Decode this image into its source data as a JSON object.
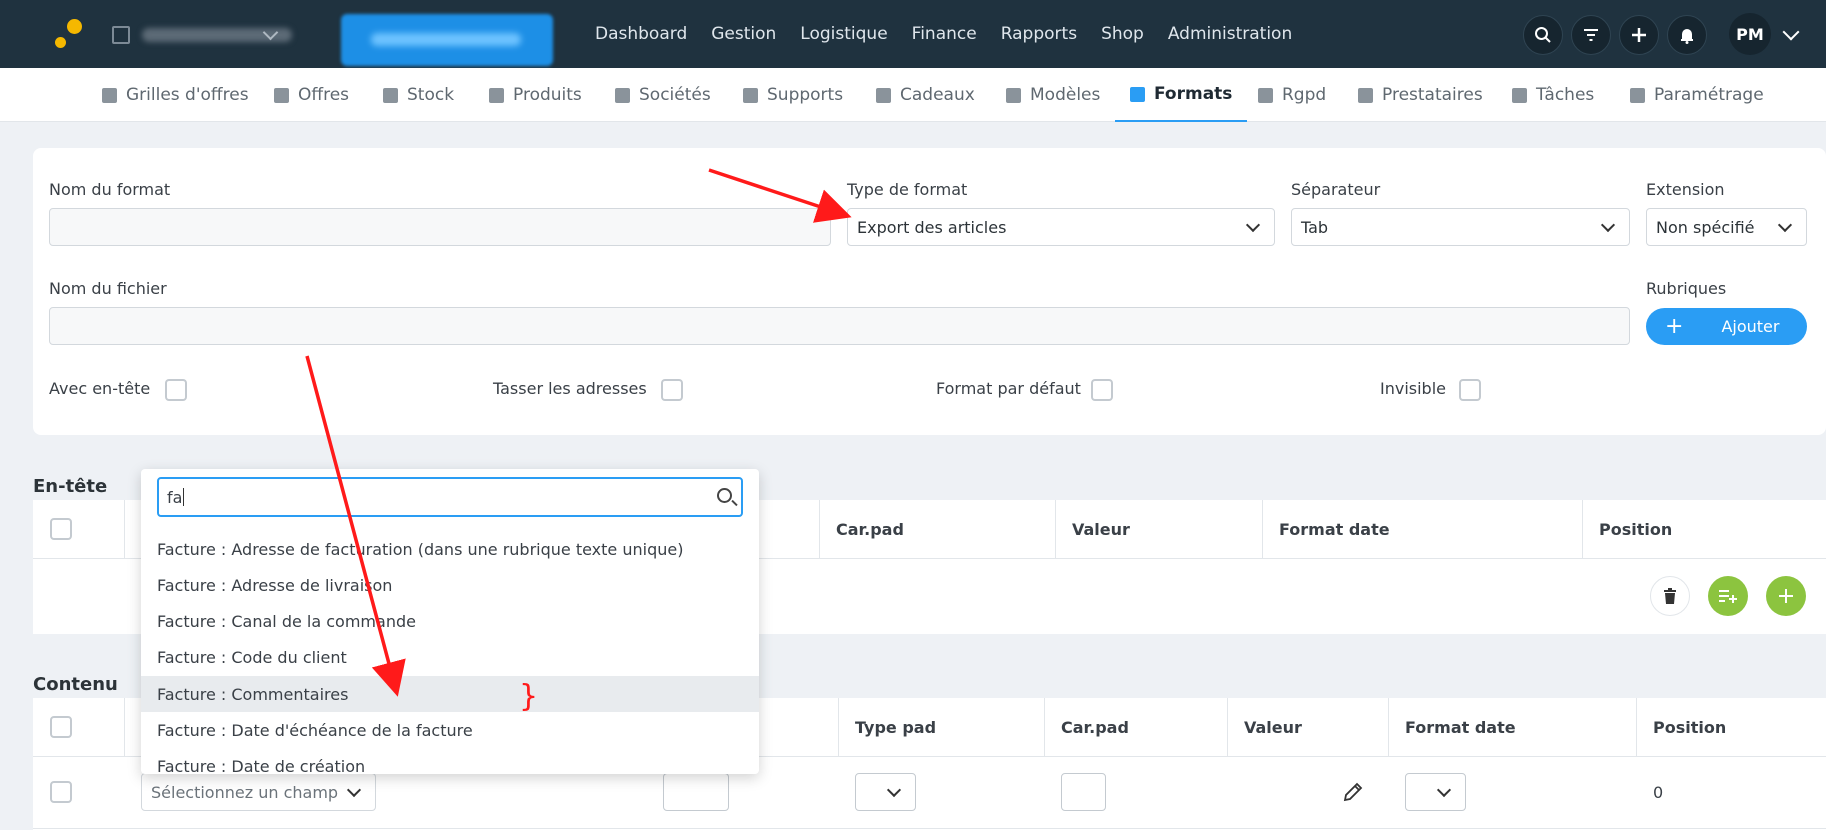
{
  "topbar": {
    "nav": [
      "Dashboard",
      "Gestion",
      "Logistique",
      "Finance",
      "Rapports",
      "Shop",
      "Administration"
    ],
    "avatar": "PM",
    "icons": [
      "search-icon",
      "filter-icon",
      "plus-icon",
      "bell-icon"
    ]
  },
  "subnav": {
    "items": [
      {
        "label": "Grilles d'offres",
        "icon": "grid-icon"
      },
      {
        "label": "Offres",
        "icon": "book-icon"
      },
      {
        "label": "Stock",
        "icon": "cloud-upload-icon"
      },
      {
        "label": "Produits",
        "icon": "cart-icon"
      },
      {
        "label": "Sociétés",
        "icon": "building-icon"
      },
      {
        "label": "Supports",
        "icon": "help-circle-icon"
      },
      {
        "label": "Cadeaux",
        "icon": "gift-icon"
      },
      {
        "label": "Modèles",
        "icon": "paint-roller-icon"
      },
      {
        "label": "Formats",
        "icon": "file-icon"
      },
      {
        "label": "Rgpd",
        "icon": "check-square-icon"
      },
      {
        "label": "Prestataires",
        "icon": "download-icon"
      },
      {
        "label": "Tâches",
        "icon": "calendar-check-icon"
      },
      {
        "label": "Paramétrage",
        "icon": "gear-icon"
      }
    ],
    "active": "Formats"
  },
  "form": {
    "nom_format_label": "Nom du format",
    "type_format_label": "Type de format",
    "type_format_value": "Export des articles",
    "separateur_label": "Séparateur",
    "separateur_value": "Tab",
    "extension_label": "Extension",
    "extension_value": "Non spécifié",
    "nom_fichier_label": "Nom du fichier",
    "rubriques_label": "Rubriques",
    "ajouter_label": "Ajouter",
    "avec_entete_label": "Avec en-tête",
    "tasser_label": "Tasser les adresses",
    "format_defaut_label": "Format par défaut",
    "invisible_label": "Invisible"
  },
  "entete": {
    "title": "En-tête",
    "columns": [
      "Car.pad",
      "Valeur",
      "Format date",
      "Position"
    ]
  },
  "contenu": {
    "title": "Contenu",
    "columns": [
      "Type pad",
      "Car.pad",
      "Valeur",
      "Format date",
      "Position"
    ],
    "row": {
      "champ_placeholder": "Sélectionnez un champ",
      "position": "0"
    }
  },
  "dropdown": {
    "query": "fa",
    "options": [
      "Facture : Adresse de facturation (dans une rubrique texte unique)",
      "Facture : Adresse de livraison",
      "Facture : Canal de la commande",
      "Facture : Code du client",
      "Facture : Commentaires",
      "Facture : Date d'échéance de la facture",
      "Facture : Date de création"
    ],
    "highlighted": "Facture : Commentaires"
  },
  "annotation": {
    "bracket": "}",
    "color": "#ff1a1a"
  }
}
